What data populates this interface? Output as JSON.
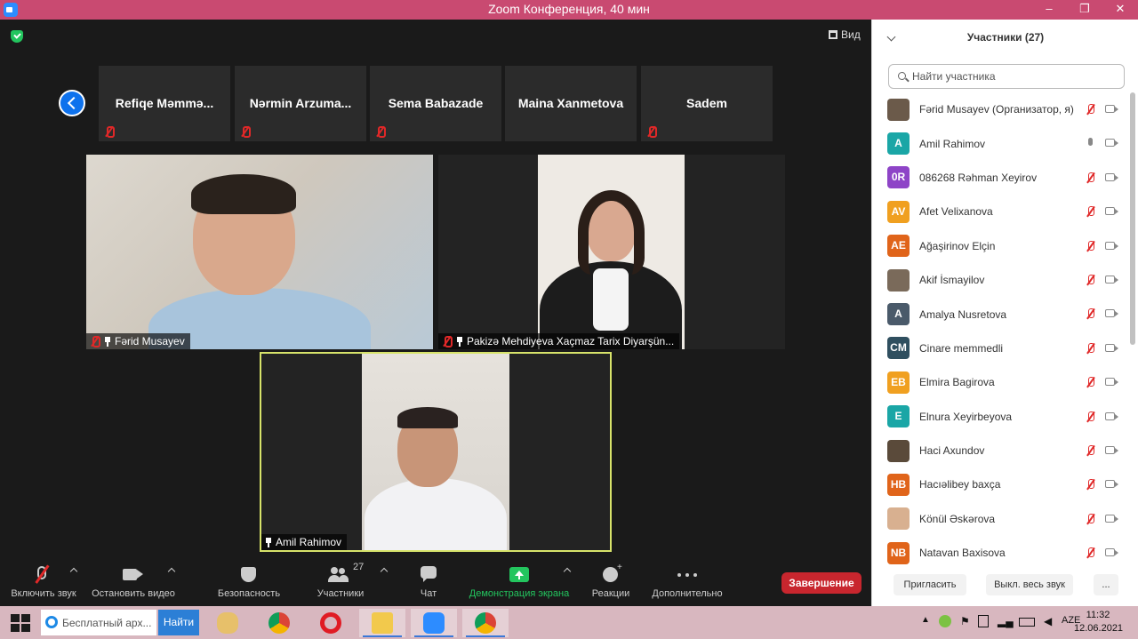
{
  "window": {
    "title": "Zoom Конференция, 40 мин",
    "min": "‒",
    "max": "❐",
    "close": "✕"
  },
  "meeting": {
    "view_label": "Вид",
    "strip": [
      {
        "name": "Refiqe  Məmmə..."
      },
      {
        "name": "Nərmin  Arzuma..."
      },
      {
        "name": "Sema Babazade"
      },
      {
        "name": "Maina Xanmetova"
      },
      {
        "name": "Sadem"
      }
    ],
    "videos": [
      {
        "name": "Fərid Musayev"
      },
      {
        "name": "Pakizə Mehdiyeva Xaçmaz Tarix Diyarşün..."
      },
      {
        "name": "Amil Rahimov"
      }
    ]
  },
  "toolbar": {
    "unmute": "Включить звук",
    "stop_video": "Остановить видео",
    "security": "Безопасность",
    "participants": "Участники",
    "participants_count": "27",
    "chat": "Чат",
    "share": "Демонстрация экрана",
    "reactions": "Реакции",
    "more": "Дополнительно",
    "end": "Завершение"
  },
  "panel": {
    "title": "Участники (27)",
    "search_placeholder": "Найти участника",
    "participants": [
      {
        "name": "Fərid Musayev (Организатор, я)",
        "initials": "",
        "color": "#6b5a4a",
        "mic": "off"
      },
      {
        "name": "Amil Rahimov",
        "initials": "A",
        "color": "#1aa6a6",
        "mic": "on"
      },
      {
        "name": "086268 Rəhman Xeyirov",
        "initials": "0R",
        "color": "#8e44c7",
        "mic": "off"
      },
      {
        "name": "Afet Velixanova",
        "initials": "AV",
        "color": "#f0a020",
        "mic": "off"
      },
      {
        "name": "Ağaşirinov Elçin",
        "initials": "AE",
        "color": "#e0641a",
        "mic": "off"
      },
      {
        "name": "Akif İsmayilov",
        "initials": "",
        "color": "#7a6a5a",
        "mic": "off"
      },
      {
        "name": "Amalya Nusretova",
        "initials": "A",
        "color": "#4a5a6a",
        "mic": "off"
      },
      {
        "name": "Cinare memmedli",
        "initials": "CM",
        "color": "#2f4f5f",
        "mic": "off"
      },
      {
        "name": "Elmira Bagirova",
        "initials": "EB",
        "color": "#f0a020",
        "mic": "off"
      },
      {
        "name": "Elnura Xeyirbeyova",
        "initials": "E",
        "color": "#1aa6a6",
        "mic": "off"
      },
      {
        "name": "Haci Axundov",
        "initials": "",
        "color": "#5a4a3a",
        "mic": "off"
      },
      {
        "name": "Hacıəlibey baxça",
        "initials": "HB",
        "color": "#e0641a",
        "mic": "off"
      },
      {
        "name": "Könül Əskərova",
        "initials": "",
        "color": "#d8b090",
        "mic": "off"
      },
      {
        "name": "Natavan Baxisova",
        "initials": "NB",
        "color": "#e0641a",
        "mic": "off"
      }
    ],
    "invite": "Пригласить",
    "mute_all": "Выкл. весь звук",
    "more": "..."
  },
  "taskbar": {
    "search_text": "Бесплатный арх...",
    "find_label": "Найти",
    "lang": "AZE",
    "time": "11:32",
    "date": "12.06.2021"
  }
}
